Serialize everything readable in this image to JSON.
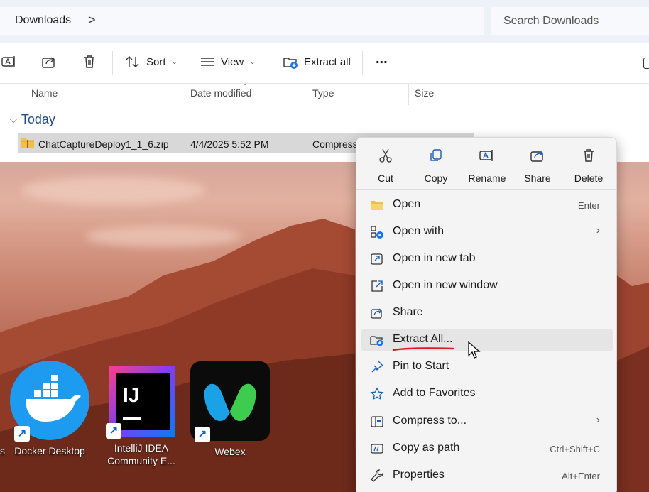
{
  "address": {
    "crumb": "Downloads",
    "chevron": ">",
    "search_placeholder": "Search Downloads"
  },
  "toolbar": {
    "sort_label": "Sort",
    "view_label": "View",
    "extract_label": "Extract all",
    "more_label": "..."
  },
  "columns": {
    "name": "Name",
    "date": "Date modified",
    "type": "Type",
    "size": "Size"
  },
  "group": {
    "label": "Today"
  },
  "file": {
    "name": "ChatCaptureDeploy1_1_6.zip",
    "date": "4/4/2025 5:52 PM",
    "type": "Compress"
  },
  "context_menu": {
    "quick": {
      "cut": "Cut",
      "copy": "Copy",
      "rename": "Rename",
      "share": "Share",
      "delete": "Delete"
    },
    "items": [
      {
        "label": "Open",
        "shortcut": "Enter"
      },
      {
        "label": "Open with",
        "shortcut": ""
      },
      {
        "label": "Open in new tab",
        "shortcut": ""
      },
      {
        "label": "Open in new window",
        "shortcut": ""
      },
      {
        "label": "Share",
        "shortcut": ""
      },
      {
        "label": "Extract All...",
        "shortcut": ""
      },
      {
        "label": "Pin to Start",
        "shortcut": ""
      },
      {
        "label": "Add to Favorites",
        "shortcut": ""
      },
      {
        "label": "Compress to...",
        "shortcut": ""
      },
      {
        "label": "Copy as path",
        "shortcut": "Ctrl+Shift+C"
      },
      {
        "label": "Properties",
        "shortcut": "Alt+Enter"
      }
    ],
    "submenu_glyph": "›"
  },
  "desktop": {
    "partial_label": "s",
    "icons": [
      {
        "caption": "Docker Desktop"
      },
      {
        "caption_line1": "IntelliJ IDEA",
        "caption_line2": "Community E..."
      },
      {
        "caption": "Webex"
      }
    ],
    "intellij_glyph": "IJ",
    "shortcut_glyph": "↗"
  },
  "colors": {
    "accent": "#1d4c86",
    "annotation": "#e0141e",
    "docker": "#1d9bf0",
    "intellij_bg": "#000000"
  }
}
